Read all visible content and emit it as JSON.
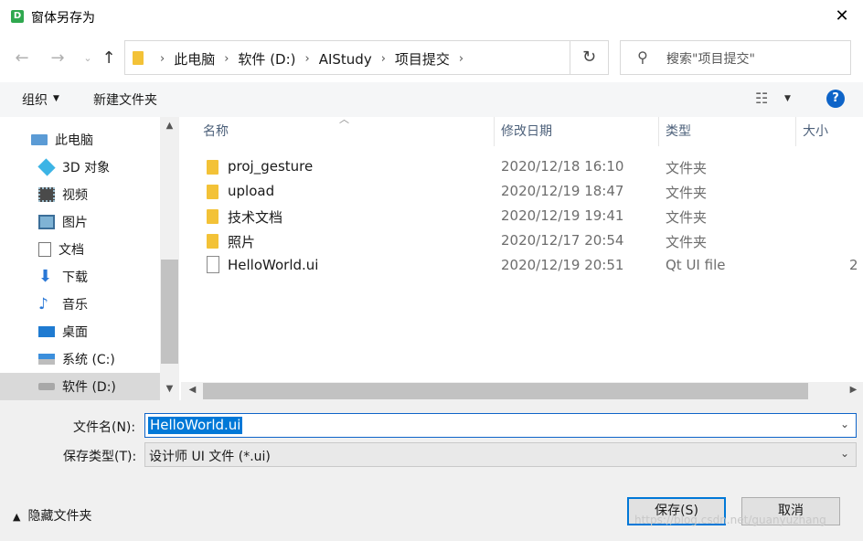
{
  "window": {
    "icon_letter": "D",
    "title": "窗体另存为",
    "close_glyph": "✕"
  },
  "address": {
    "crumbs": [
      "此电脑",
      "软件 (D:)",
      "AIStudy",
      "项目提交"
    ],
    "search_placeholder": "搜索\"项目提交\""
  },
  "toolbar": {
    "organize": "组织",
    "new_folder": "新建文件夹",
    "help": "?"
  },
  "nav": {
    "items": [
      {
        "label": "此电脑",
        "icon": "computer-icon"
      },
      {
        "label": "3D 对象",
        "icon": "3d-objects-icon"
      },
      {
        "label": "视频",
        "icon": "video-icon"
      },
      {
        "label": "图片",
        "icon": "pictures-icon"
      },
      {
        "label": "文档",
        "icon": "documents-icon"
      },
      {
        "label": "下载",
        "icon": "download-icon"
      },
      {
        "label": "音乐",
        "icon": "music-icon"
      },
      {
        "label": "桌面",
        "icon": "desktop-icon"
      },
      {
        "label": "系统 (C:)",
        "icon": "drive-c-icon"
      },
      {
        "label": "软件 (D:)",
        "icon": "drive-d-icon"
      }
    ],
    "selected_index": 9
  },
  "columns": {
    "name": "名称",
    "date": "修改日期",
    "type": "类型",
    "size": "大小"
  },
  "files": [
    {
      "name": "proj_gesture",
      "date": "2020/12/18 16:10",
      "type": "文件夹",
      "size": "",
      "kind": "folder"
    },
    {
      "name": "upload",
      "date": "2020/12/19 18:47",
      "type": "文件夹",
      "size": "",
      "kind": "folder"
    },
    {
      "name": "技术文档",
      "date": "2020/12/19 19:41",
      "type": "文件夹",
      "size": "",
      "kind": "folder"
    },
    {
      "name": "照片",
      "date": "2020/12/17 20:54",
      "type": "文件夹",
      "size": "",
      "kind": "folder"
    },
    {
      "name": "HelloWorld.ui",
      "date": "2020/12/19 20:51",
      "type": "Qt UI file",
      "size": "2",
      "kind": "file"
    }
  ],
  "form": {
    "filename_label": "文件名(N):",
    "filename_value": "HelloWorld.ui",
    "filetype_label": "保存类型(T):",
    "filetype_value": "设计师 UI 文件 (*.ui)",
    "hide_folders": "隐藏文件夹",
    "save": "保存(S)",
    "cancel": "取消"
  },
  "watermark": "https://blog.csdn.net/guanyuzhang"
}
